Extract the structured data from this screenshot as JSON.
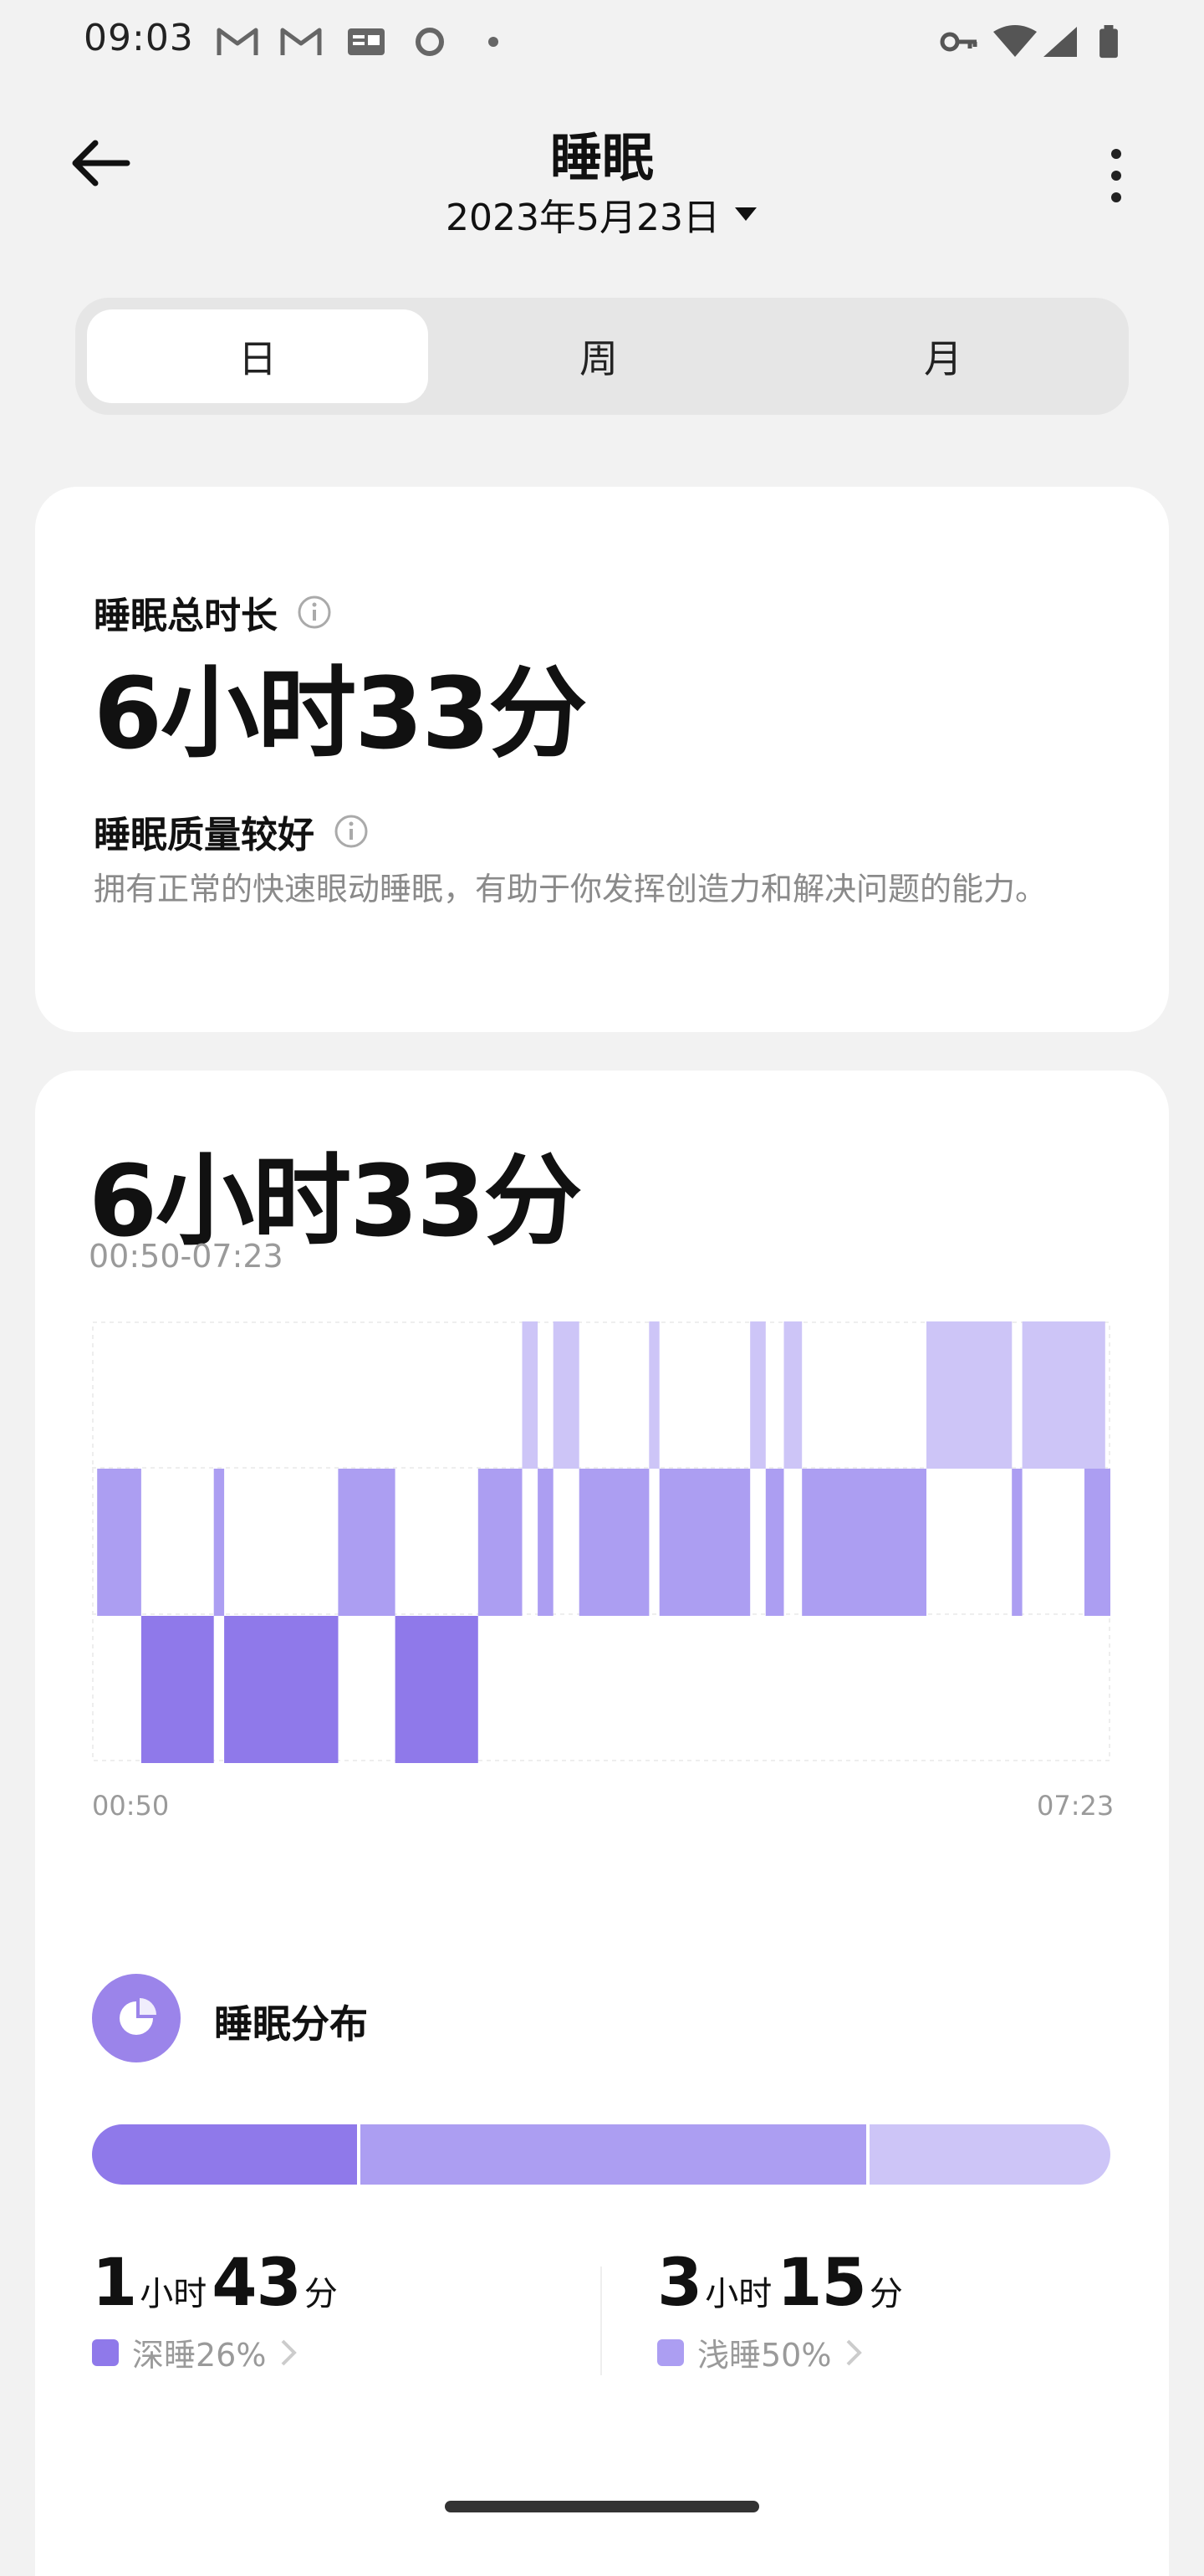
{
  "status_bar": {
    "time": "09:03",
    "left_icons": [
      "gmail-icon",
      "gmail-icon",
      "news-icon",
      "circle-icon",
      "dot-icon"
    ],
    "right_icons": [
      "vpn-key-icon",
      "wifi-icon",
      "signal-icon",
      "battery-icon"
    ]
  },
  "header": {
    "title": "睡眠",
    "date": "2023年5月23日"
  },
  "tabs": [
    {
      "label": "日",
      "active": true
    },
    {
      "label": "周",
      "active": false
    },
    {
      "label": "月",
      "active": false
    }
  ],
  "summary": {
    "total_label": "睡眠总时长",
    "total_value": "6小时33分",
    "quality_label": "睡眠质量较好",
    "quality_desc": "拥有正常的快速眼动睡眠，有助于你发挥创造力和解决问题的能力。"
  },
  "sleep_chart": {
    "duration": "6小时33分",
    "range": "00:50-07:23",
    "x_start": "00:50",
    "x_end": "07:23",
    "colors": {
      "deep": "#8f79ea",
      "light": "#ac9ef2",
      "rem": "#cdc5f7"
    },
    "chart_data": {
      "type": "hypnogram",
      "x_range": [
        "00:50",
        "07:23"
      ],
      "stages_top_to_bottom": [
        "rem",
        "light",
        "deep"
      ],
      "segments": [
        {
          "stage": "light",
          "start": "00:52",
          "end": "01:09"
        },
        {
          "stage": "deep",
          "start": "01:09",
          "end": "01:37"
        },
        {
          "stage": "light",
          "start": "01:37",
          "end": "01:41"
        },
        {
          "stage": "deep",
          "start": "01:41",
          "end": "02:25"
        },
        {
          "stage": "light",
          "start": "02:25",
          "end": "02:47"
        },
        {
          "stage": "deep",
          "start": "02:47",
          "end": "03:19"
        },
        {
          "stage": "light",
          "start": "03:19",
          "end": "03:36"
        },
        {
          "stage": "rem",
          "start": "03:36",
          "end": "03:42"
        },
        {
          "stage": "light",
          "start": "03:42",
          "end": "03:48"
        },
        {
          "stage": "rem",
          "start": "03:48",
          "end": "03:58"
        },
        {
          "stage": "light",
          "start": "03:58",
          "end": "04:25"
        },
        {
          "stage": "rem",
          "start": "04:25",
          "end": "04:29"
        },
        {
          "stage": "light",
          "start": "04:29",
          "end": "05:04"
        },
        {
          "stage": "rem",
          "start": "05:04",
          "end": "05:10"
        },
        {
          "stage": "light",
          "start": "05:10",
          "end": "05:17"
        },
        {
          "stage": "rem",
          "start": "05:17",
          "end": "05:24"
        },
        {
          "stage": "light",
          "start": "05:24",
          "end": "06:12"
        },
        {
          "stage": "rem",
          "start": "06:12",
          "end": "06:45"
        },
        {
          "stage": "light",
          "start": "06:45",
          "end": "06:49"
        },
        {
          "stage": "rem",
          "start": "06:49",
          "end": "07:21"
        },
        {
          "stage": "light",
          "start": "07:13",
          "end": "07:23"
        }
      ]
    }
  },
  "distribution": {
    "title": "睡眠分布",
    "segments": [
      {
        "name": "deep",
        "percent": 26,
        "color": "#8f79ea"
      },
      {
        "name": "light",
        "percent": 50,
        "color": "#ac9ef2"
      },
      {
        "name": "rem",
        "percent": 24,
        "color": "#cdc5f7"
      }
    ],
    "stats": [
      {
        "hours": "1",
        "hour_unit": "小时",
        "minutes": "43",
        "minute_unit": "分",
        "label": "深睡26%",
        "color": "#8f79ea"
      },
      {
        "hours": "3",
        "hour_unit": "小时",
        "minutes": "15",
        "minute_unit": "分",
        "label": "浅睡50%",
        "color": "#ac9ef2"
      }
    ]
  }
}
